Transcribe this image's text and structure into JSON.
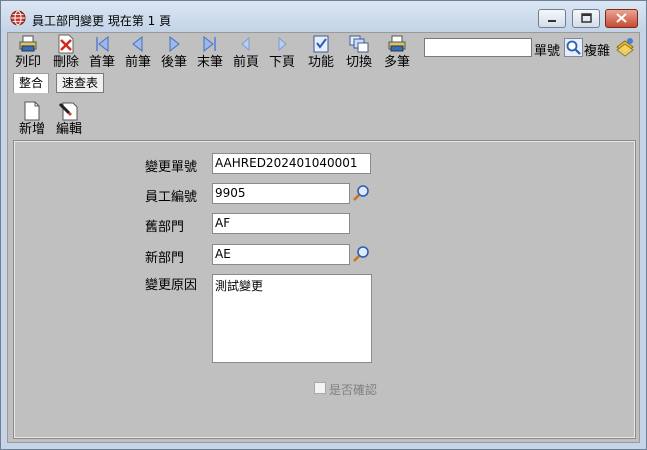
{
  "window": {
    "title": "員工部門變更  現在第 1 頁"
  },
  "toolbar": {
    "items": [
      {
        "label": "列印",
        "icon": "print-icon"
      },
      {
        "label": "刪除",
        "icon": "delete-icon"
      },
      {
        "label": "首筆",
        "icon": "first-record-icon"
      },
      {
        "label": "前筆",
        "icon": "prev-record-icon"
      },
      {
        "label": "後筆",
        "icon": "next-record-icon"
      },
      {
        "label": "末筆",
        "icon": "last-record-icon"
      },
      {
        "label": "前頁",
        "icon": "prev-page-icon"
      },
      {
        "label": "下頁",
        "icon": "next-page-icon"
      },
      {
        "label": "功能",
        "icon": "function-icon"
      },
      {
        "label": "切換",
        "icon": "switch-icon"
      },
      {
        "label": "多筆",
        "icon": "multi-record-icon"
      }
    ],
    "search_value": "",
    "search_label": "單號",
    "copy_label": "複雜"
  },
  "tabs": [
    {
      "label": "整合",
      "active": true
    },
    {
      "label": "速查表",
      "active": false
    }
  ],
  "actions": [
    {
      "label": "新增",
      "icon": "new-document-icon"
    },
    {
      "label": "編輯",
      "icon": "edit-document-icon"
    }
  ],
  "form": {
    "change_no": {
      "label": "變更單號",
      "value": "AAHRED202401040001"
    },
    "employee_no": {
      "label": "員工編號",
      "value": "9905"
    },
    "old_dept": {
      "label": "舊部門",
      "value": "AF"
    },
    "new_dept": {
      "label": "新部門",
      "value": "AE"
    },
    "reason": {
      "label": "變更原因",
      "value": "測試變更"
    },
    "confirm": {
      "label": "是否確認",
      "checked": false
    }
  }
}
